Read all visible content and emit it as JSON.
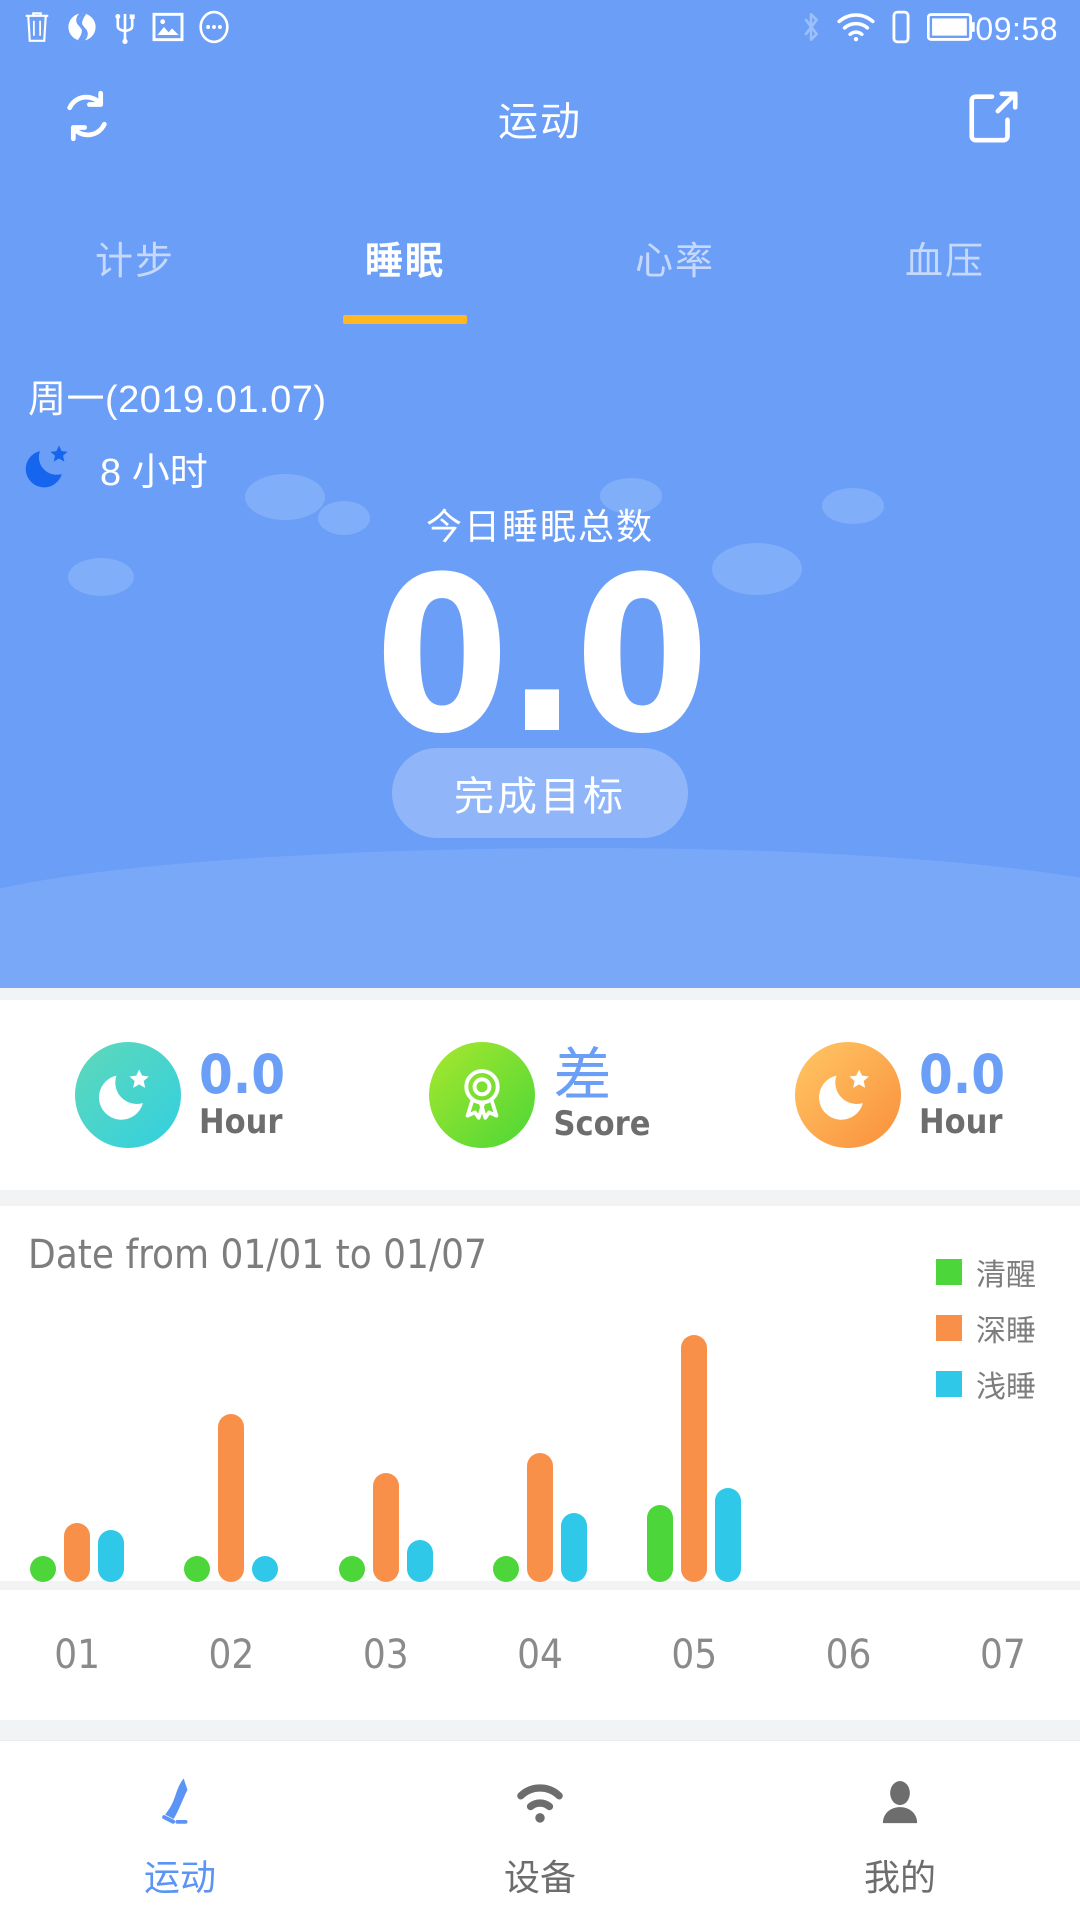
{
  "statusbar": {
    "time": "09:58",
    "left_icons": [
      "trash-icon",
      "globe-icon",
      "usb-icon",
      "image-icon",
      "more-icon"
    ],
    "right_icons": [
      "bluetooth-icon",
      "wifi-icon",
      "sim-icon",
      "battery-icon"
    ]
  },
  "header": {
    "title": "运动",
    "refresh_icon": "refresh-icon",
    "share_icon": "share-external-icon"
  },
  "tabs": [
    {
      "label": "计步",
      "active": false
    },
    {
      "label": "睡眠",
      "active": true
    },
    {
      "label": "心率",
      "active": false
    },
    {
      "label": "血压",
      "active": false
    }
  ],
  "hero": {
    "date": "周一(2019.01.07)",
    "moon_icon": "moon-star-icon",
    "target_hours": "8 小时",
    "subtitle": "今日睡眠总数",
    "total_value": "0.0",
    "goal_button": "完成目标",
    "accent_underline": "#ffb726",
    "background": "#6b9ef7"
  },
  "stats": [
    {
      "icon": "moon-star-icon",
      "circle_color": "#3fd4ce",
      "value": "0.0",
      "unit": "Hour"
    },
    {
      "icon": "medal-icon",
      "circle_color": "#74e033",
      "value": "差",
      "unit": "Score"
    },
    {
      "icon": "moon-star-icon",
      "circle_color": "#fba24a",
      "value": "0.0",
      "unit": "Hour"
    }
  ],
  "chart_data": {
    "type": "bar",
    "title": "Date from 01/01 to 01/07",
    "xlabel": "",
    "ylabel": "",
    "categories": [
      "01",
      "02",
      "03",
      "04",
      "05",
      "06",
      "07"
    ],
    "series": [
      {
        "name": "清醒",
        "color": "#4cd639",
        "values": [
          0.35,
          0.35,
          0.35,
          0.5,
          1.55,
          0,
          0
        ]
      },
      {
        "name": "深睡",
        "color": "#f9904a",
        "values": [
          1.2,
          3.4,
          2.2,
          2.6,
          5.0,
          0,
          0
        ]
      },
      {
        "name": "浅睡",
        "color": "#2fc8e8",
        "values": [
          1.05,
          0.3,
          0.85,
          1.4,
          1.9,
          0,
          0
        ]
      }
    ],
    "ylim": [
      0,
      5.5
    ],
    "grid": false,
    "legend_position": "top-right"
  },
  "bottomnav": [
    {
      "label": "运动",
      "icon": "running-shoe-icon",
      "active": true
    },
    {
      "label": "设备",
      "icon": "device-signal-icon",
      "active": false
    },
    {
      "label": "我的",
      "icon": "person-icon",
      "active": false
    }
  ],
  "colors": {
    "brand_blue": "#6b9ef7",
    "accent_yellow": "#ffb726",
    "value_blue": "#6b9ef7",
    "awake_green": "#4cd639",
    "deep_orange": "#f9904a",
    "light_cyan": "#2fc8e8"
  }
}
